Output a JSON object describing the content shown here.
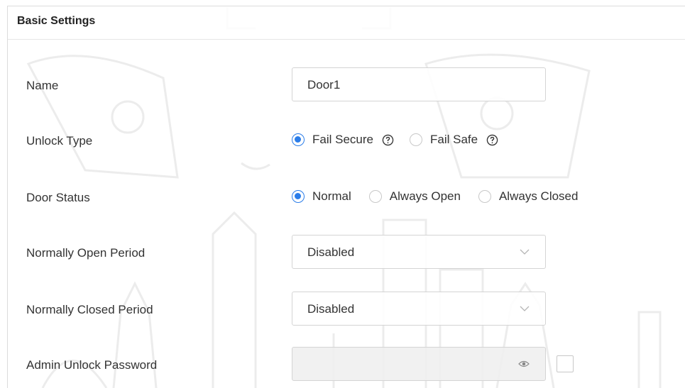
{
  "section": {
    "title": "Basic Settings"
  },
  "name_field": {
    "label": "Name",
    "value": "Door1"
  },
  "unlock_type": {
    "label": "Unlock Type",
    "options": [
      {
        "label": "Fail Secure",
        "checked": true
      },
      {
        "label": "Fail Safe",
        "checked": false
      }
    ]
  },
  "door_status": {
    "label": "Door Status",
    "options": [
      {
        "label": "Normal",
        "checked": true
      },
      {
        "label": "Always Open",
        "checked": false
      },
      {
        "label": "Always Closed",
        "checked": false
      }
    ]
  },
  "normally_open_period": {
    "label": "Normally Open Period",
    "value": "Disabled"
  },
  "normally_closed_period": {
    "label": "Normally Closed Period",
    "value": "Disabled"
  },
  "admin_unlock_password": {
    "label": "Admin Unlock Password",
    "value": ""
  },
  "colors": {
    "accent": "#2b7de9",
    "border": "#d4d4d4",
    "text": "#333333"
  },
  "icons": {
    "help": "question-circle-icon",
    "dropdown": "chevron-down-icon",
    "visibility": "eye-icon"
  }
}
